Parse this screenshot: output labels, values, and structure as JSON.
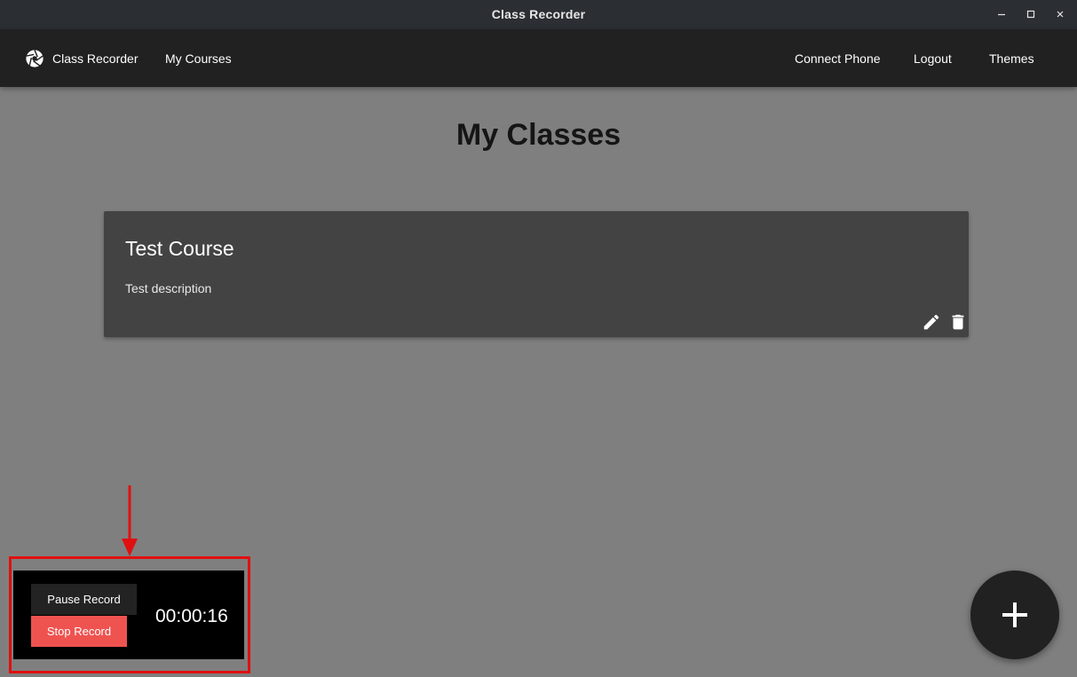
{
  "window": {
    "title": "Class Recorder",
    "controls": [
      "minimize-icon",
      "maximize-icon",
      "close-icon"
    ]
  },
  "navbar": {
    "brand": {
      "icon": "camera-aperture-icon",
      "label": "Class Recorder"
    },
    "left_links": [
      {
        "label": "My Courses"
      }
    ],
    "right_links": [
      {
        "label": "Connect Phone"
      },
      {
        "label": "Logout"
      },
      {
        "label": "Themes"
      }
    ]
  },
  "page": {
    "title": "My Classes"
  },
  "courses": [
    {
      "title": "Test Course",
      "description": "Test description",
      "actions": [
        "edit-pencil-icon",
        "delete-trash-icon"
      ]
    }
  ],
  "recorder": {
    "pause_label": "Pause Record",
    "stop_label": "Stop Record",
    "elapsed": "00:00:16"
  },
  "fab": {
    "icon": "plus-icon"
  },
  "annotation": {
    "color": "#e01010"
  },
  "colors": {
    "titlebar": "#2b2e33",
    "navbar": "#212121",
    "background": "#7f7f7f",
    "card": "#434343",
    "stop_button": "#ef5350",
    "recorder_panel": "#000000"
  }
}
